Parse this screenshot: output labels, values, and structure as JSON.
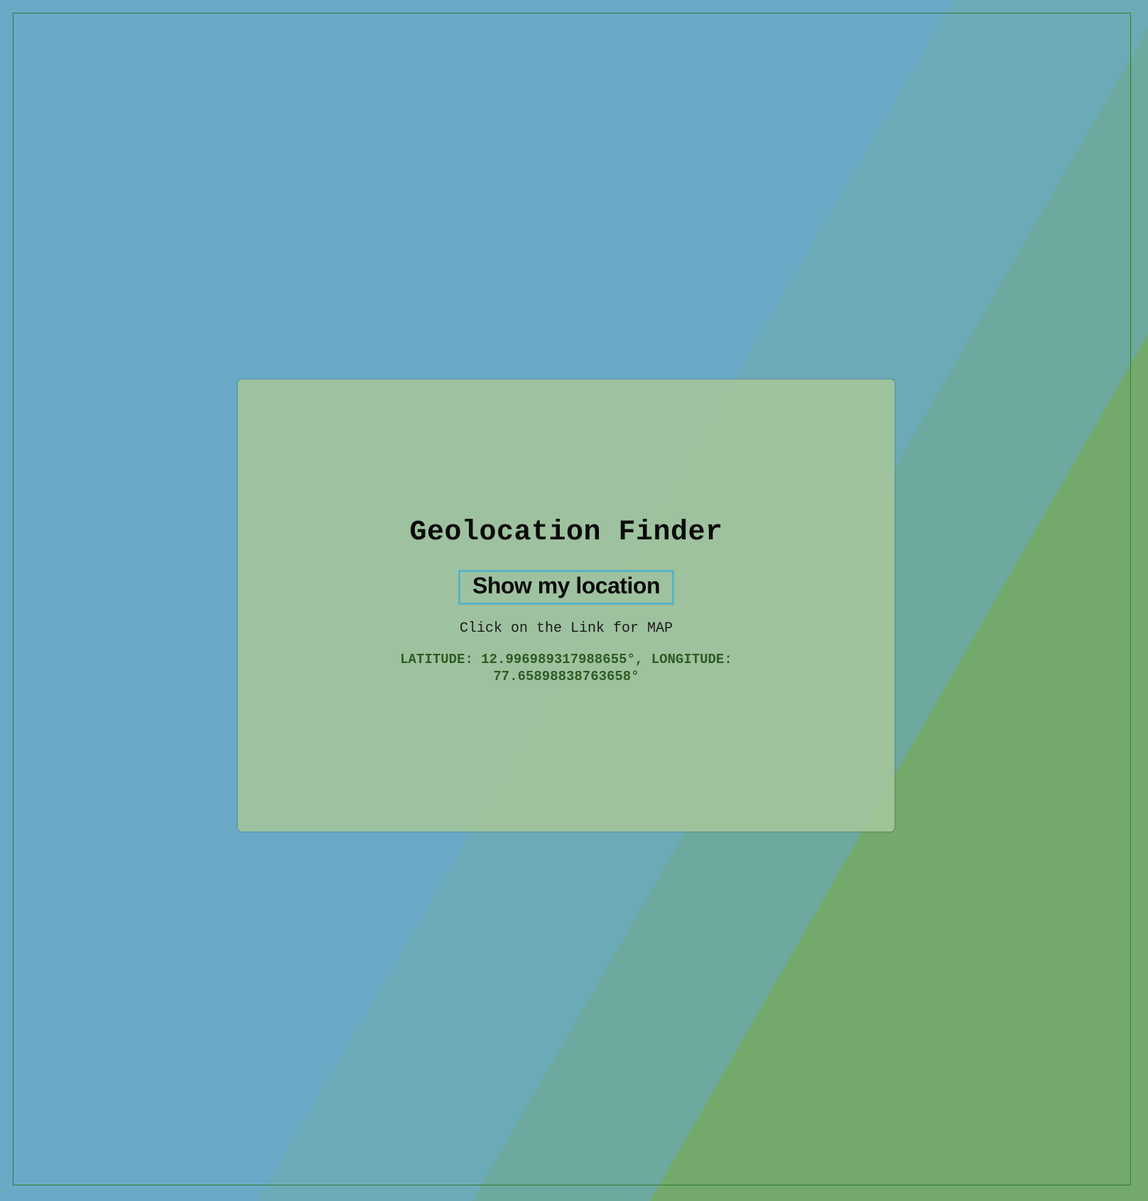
{
  "page": {
    "title": "Geolocation Finder",
    "button_label": "Show my location",
    "hint": "Click on the Link for MAP",
    "coordinates_text": "LATITUDE: 12.996989317988655°, LONGITUDE: 77.65898838763658°"
  },
  "colors": {
    "background_blue": "#6aaac7",
    "stripe_teal": "#6da99e",
    "background_green": "#73a96a",
    "card": "#a3c49b",
    "frame_border": "#2e7d32",
    "button_border": "#58b3c7",
    "coordinates_text": "#2f5a25"
  }
}
